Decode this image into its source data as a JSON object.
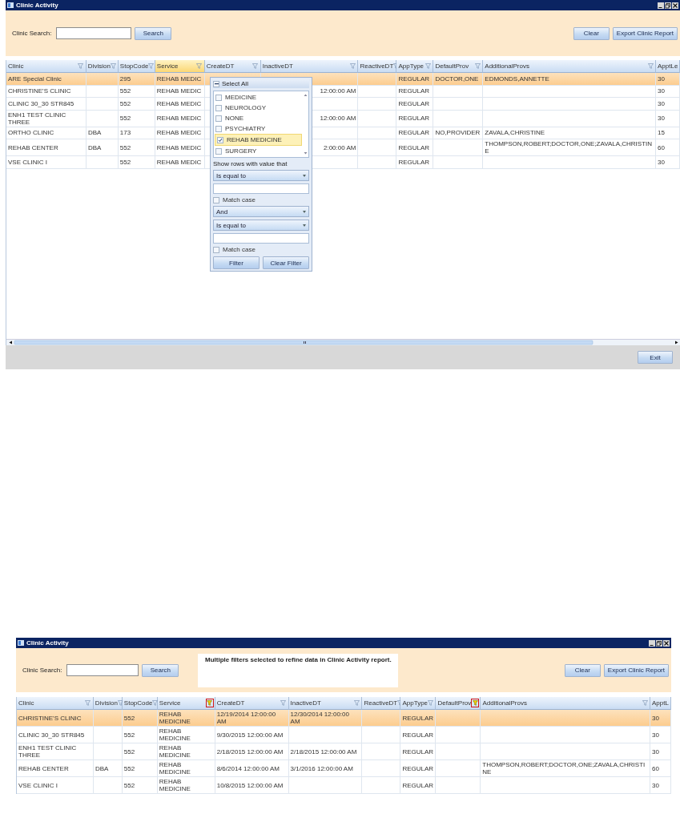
{
  "windows": [
    {
      "title": "Clinic Activity",
      "search": {
        "label": "Clinic Search:",
        "button": "Search"
      },
      "buttons": [
        "Clear",
        "Export Clinic Report"
      ],
      "columns": [
        {
          "label": "Clinic",
          "filtered": false,
          "active": false
        },
        {
          "label": "Division",
          "filtered": false,
          "active": false
        },
        {
          "label": "StopCode",
          "filtered": false,
          "active": false
        },
        {
          "label": "Service",
          "filtered": false,
          "active": true
        },
        {
          "label": "CreateDT",
          "filtered": false,
          "active": false
        },
        {
          "label": "InactiveDT",
          "filtered": false,
          "active": false
        },
        {
          "label": "ReactiveDT",
          "filtered": false,
          "active": false
        },
        {
          "label": "AppType",
          "filtered": false,
          "active": false
        },
        {
          "label": "DefaultProv",
          "filtered": false,
          "active": false
        },
        {
          "label": "AdditionalProvs",
          "filtered": false,
          "active": false
        },
        {
          "label": "ApptLe"
        }
      ],
      "rows": [
        {
          "selected": true,
          "cells": [
            "ARE Special Clinic",
            null,
            "295",
            "REHAB MEDIC",
            null,
            null,
            null,
            "REGULAR",
            "DOCTOR,ONE",
            "EDMONDS,ANNETTE",
            "30"
          ]
        },
        {
          "selected": false,
          "cells": [
            "CHRISTINE'S CLINIC",
            null,
            "552",
            "REHAB MEDIC",
            null,
            "12:00:00 AM",
            null,
            "REGULAR",
            null,
            null,
            "30"
          ]
        },
        {
          "selected": false,
          "cells": [
            "CLINIC 30_30 STR845",
            null,
            "552",
            "REHAB MEDIC",
            null,
            null,
            null,
            "REGULAR",
            null,
            null,
            "30"
          ]
        },
        {
          "selected": false,
          "cells": [
            "ENH1 TEST CLINIC THREE",
            null,
            "552",
            "REHAB MEDIC",
            null,
            "12:00:00 AM",
            null,
            "REGULAR",
            null,
            null,
            "30"
          ]
        },
        {
          "selected": false,
          "cells": [
            "ORTHO CLINIC",
            "DBA",
            "173",
            "REHAB MEDIC",
            null,
            null,
            null,
            "REGULAR",
            "NO,PROVIDER",
            "ZAVALA,CHRISTINE",
            "15"
          ]
        },
        {
          "selected": false,
          "cells": [
            "REHAB CENTER",
            "DBA",
            "552",
            "REHAB MEDIC",
            null,
            "2:00:00 AM",
            null,
            "REGULAR",
            null,
            "THOMPSON,ROBERT;DOCTOR,ONE;ZAVALA,CHRISTINE",
            "60"
          ]
        },
        {
          "selected": false,
          "cells": [
            "VSE CLINIC I",
            null,
            "552",
            "REHAB MEDIC",
            null,
            null,
            null,
            "REGULAR",
            null,
            null,
            "30"
          ]
        }
      ],
      "filter_popup": {
        "select_all": {
          "label": "Select All",
          "indeterminate": true
        },
        "items": [
          {
            "label": "MEDICINE",
            "checked": false,
            "selected": false
          },
          {
            "label": "NEUROLOGY",
            "checked": false,
            "selected": false
          },
          {
            "label": "NONE",
            "checked": false,
            "selected": false
          },
          {
            "label": "PSYCHIATRY",
            "checked": false,
            "selected": false
          },
          {
            "label": "REHAB MEDICINE",
            "checked": true,
            "selected": true
          },
          {
            "label": "SURGERY",
            "checked": false,
            "selected": false
          }
        ],
        "prompt": "Show rows with value that",
        "operator_1": "Is equal to",
        "match_case_1": {
          "label": "Match case",
          "checked": false
        },
        "logic": "And",
        "operator_2": "Is equal to",
        "match_case_2": {
          "label": "Match case",
          "checked": false
        },
        "buttons": [
          "Filter",
          "Clear Filter"
        ]
      },
      "footer_button": "Exit"
    },
    {
      "title": "Clinic Activity",
      "search": {
        "label": "Clinic Search:",
        "button": "Search"
      },
      "message": "Multiple filters selected to refine data in Clinic Activity report.",
      "buttons": [
        "Clear",
        "Export Clinic Report"
      ],
      "columns": [
        {
          "label": "Clinic",
          "filtered": false,
          "active": false
        },
        {
          "label": "Division",
          "filtered": false,
          "active": false
        },
        {
          "label": "StopCode",
          "filtered": false,
          "active": false
        },
        {
          "label": "Service",
          "filtered": true,
          "active": false
        },
        {
          "label": "CreateDT",
          "filtered": false,
          "active": false
        },
        {
          "label": "InactiveDT",
          "filtered": false,
          "active": false
        },
        {
          "label": "ReactiveDT",
          "filtered": false,
          "active": false
        },
        {
          "label": "AppType",
          "filtered": false,
          "active": false
        },
        {
          "label": "DefaultProv",
          "filtered": true,
          "active": false
        },
        {
          "label": "AdditionalProvs",
          "filtered": false,
          "active": false
        },
        {
          "label": "ApptL"
        }
      ],
      "rows": [
        {
          "selected": true,
          "cells": [
            "CHRISTINE'S CLINIC",
            null,
            "552",
            "REHAB MEDICINE",
            "12/19/2014 12:00:00 AM",
            "12/30/2014 12:00:00 AM",
            null,
            "REGULAR",
            null,
            null,
            "30"
          ]
        },
        {
          "selected": false,
          "cells": [
            "CLINIC 30_30 STR845",
            null,
            "552",
            "REHAB MEDICINE",
            "9/30/2015 12:00:00 AM",
            null,
            null,
            "REGULAR",
            null,
            null,
            "30"
          ]
        },
        {
          "selected": false,
          "cells": [
            "ENH1 TEST CLINIC THREE",
            null,
            "552",
            "REHAB MEDICINE",
            "2/18/2015 12:00:00 AM",
            "2/18/2015 12:00:00 AM",
            null,
            "REGULAR",
            null,
            null,
            "30"
          ]
        },
        {
          "selected": false,
          "cells": [
            "REHAB CENTER",
            "DBA",
            "552",
            "REHAB MEDICINE",
            "8/6/2014 12:00:00 AM",
            "3/1/2016 12:00:00 AM",
            null,
            "REGULAR",
            null,
            "THOMPSON,ROBERT;DOCTOR,ONE;ZAVALA,CHRISTINE",
            "60"
          ]
        },
        {
          "selected": false,
          "cells": [
            "VSE CLINIC I",
            null,
            "552",
            "REHAB MEDICINE",
            "10/8/2015 12:00:00 AM",
            null,
            null,
            "REGULAR",
            null,
            null,
            "30"
          ]
        }
      ]
    }
  ]
}
